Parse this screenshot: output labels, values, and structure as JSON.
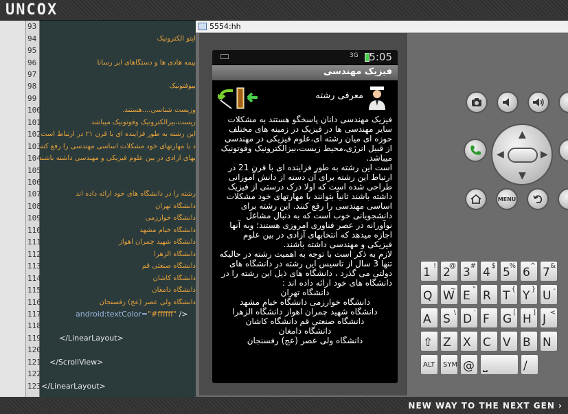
{
  "banner": {
    "brand": "UNCOX",
    "slogan": "NEW WAY TO THE NEXT GEN ›"
  },
  "editor": {
    "lines": [
      {
        "num": "93",
        "text": ""
      },
      {
        "num": "94",
        "text": "ایتو الکترونیک"
      },
      {
        "num": "95",
        "text": ""
      },
      {
        "num": "96",
        "text": "بیمه هادی ها و دستگاهای ابر رسانا"
      },
      {
        "num": "97",
        "text": ""
      },
      {
        "num": "98",
        "text": "بیوفتونیک"
      },
      {
        "num": "99",
        "text": ""
      },
      {
        "num": "100",
        "text": "وزیست شناسی....هستند."
      },
      {
        "num": "101",
        "text": "زیست،بیزالکترونیک وفوتونیک میباشد"
      },
      {
        "num": "102",
        "text": "این رشته به طور فزاینده ای  با قرن ۲۱ در ارتباط است"
      },
      {
        "num": "103",
        "text": "د با مهارتهای خود مشکلات اساسی مهندسی را رفع کنند"
      },
      {
        "num": "104",
        "text": "یهای ارادی در بین علوم فیزیکی و مهندسی داشته باشند"
      },
      {
        "num": "105",
        "text": ""
      },
      {
        "num": "106",
        "text": ""
      },
      {
        "num": "107",
        "text": "رشته را در دانشگاه های خود ارائه داده اند"
      },
      {
        "num": "108",
        "text": "دانشگاه تهران"
      },
      {
        "num": "109",
        "text": "دانشگاه خوارزمی"
      },
      {
        "num": "110",
        "text": "دانشگاه خیام مشهد"
      },
      {
        "num": "111",
        "text": "دانشگاه شهید چمران اهواز"
      },
      {
        "num": "112",
        "text": "دانشگاه الزهرا"
      },
      {
        "num": "113",
        "text": "دانشگاه صنعتی قم"
      },
      {
        "num": "114",
        "text": "دانشگاه کاشان"
      },
      {
        "num": "115",
        "text": "دانشگاه دامغان"
      },
      {
        "num": "116",
        "text": "دانشگاه ولی عصر (عج) رفسنجان"
      },
      {
        "num": "117",
        "attr": "android:textColor=",
        "val": "\"#ffffff\"",
        "tail": " />"
      },
      {
        "num": "118",
        "text": ""
      },
      {
        "num": "119",
        "tag": "</LinearLayout>"
      },
      {
        "num": "120",
        "text": ""
      },
      {
        "num": "121",
        "tag": "</ScrollView>"
      },
      {
        "num": "122",
        "text": ""
      },
      {
        "num": "123",
        "tag": "</LinearLayout>"
      }
    ]
  },
  "emulator": {
    "window_title": "5554:hh",
    "status": {
      "network": "3G",
      "time": "5:05"
    },
    "app_title": "فیزیک مهندسی",
    "intro_label": "معرفی رشته",
    "paragraphs": [
      "فیزیک مهندسی دانان پاسخگو هستند به مشکلات سایر مهندسی ها در فیزیک در زمینه های مختلف حوزه ای میان رشته ای،علوم فیزیکی در مهندسی از قبیل انرژی،محیط زیست،بیزالکترونیک وفوتونیک میباشد.",
      "است این رشته به طور فزاینده ای  با قرن 21 در ارتباط این رشته برای آن دسته از دانش آموزانی طراحی شده است که اولا درک درستی از فیزیک داشته باشند ثانیاً بتوانند با مهارتهای خود مشکلات اساسی مهندسی را رفع کنند. این رشته برای دانشجویانی خوب است که به دنبال مشاغل نوآورانه در عصر فناوری امروزی هستند؛ وبه آنها اجازه میدهد که انتخابهای آزادی در بین علوم فیزیکی و مهندسی داشته باشند.",
      "لازم به ذکر است با توجه به اهمیت رشته در حالیکه تنها 3 سال از تاسیس این رشته در دانشگاه های دولتی می گذرد ، دانشگاه های ذیل این رشته را در دانشگاه های خود ارائه داده اند :",
      "دانشگاه تهران",
      "دانشگاه خوارزمی        دانشگاه خیام مشهد",
      "دانشگاه شهید چمران اهواز        دانشگاه الزهرا",
      "دانشگاه صنعتی قم        دانشگاه کاشان",
      "دانشگاه دامغان",
      "دانشگاه ولی عصر (عج) رفسنجان"
    ],
    "controls": {
      "menu_label": "MENU"
    },
    "keyboard": {
      "row1": [
        {
          "m": "1",
          "s": "!"
        },
        {
          "m": "2",
          "s": "@"
        },
        {
          "m": "3",
          "s": "#"
        },
        {
          "m": "4",
          "s": "$"
        },
        {
          "m": "5",
          "s": "%"
        },
        {
          "m": "6",
          "s": "^"
        },
        {
          "m": "7",
          "s": "&"
        }
      ],
      "row2": [
        {
          "m": "Q",
          "s": ""
        },
        {
          "m": "W",
          "s": "~"
        },
        {
          "m": "E",
          "s": "\""
        },
        {
          "m": "R",
          "s": ""
        },
        {
          "m": "T",
          "s": "{"
        },
        {
          "m": "Y",
          "s": "}"
        },
        {
          "m": "U",
          "s": "-"
        }
      ],
      "row3": [
        {
          "m": "A",
          "s": ""
        },
        {
          "m": "S",
          "s": "\\"
        },
        {
          "m": "D",
          "s": "'"
        },
        {
          "m": "F",
          "s": ""
        },
        {
          "m": "G",
          "s": "["
        },
        {
          "m": "H",
          "s": "]"
        },
        {
          "m": "J",
          "s": "<"
        }
      ],
      "row4": [
        {
          "m": "⇧",
          "s": ""
        },
        {
          "m": "Z",
          "s": ""
        },
        {
          "m": "X",
          "s": ""
        },
        {
          "m": "C",
          "s": ""
        },
        {
          "m": "V",
          "s": ""
        },
        {
          "m": "B",
          "s": ""
        },
        {
          "m": "N",
          "s": ""
        }
      ],
      "row5": [
        {
          "m": "ALT",
          "s": ""
        },
        {
          "m": "SYM",
          "s": ""
        },
        {
          "m": "@",
          "s": ""
        },
        {
          "m": "⎵",
          "s": ""
        },
        {
          "m": "/",
          "s": ""
        }
      ]
    }
  }
}
